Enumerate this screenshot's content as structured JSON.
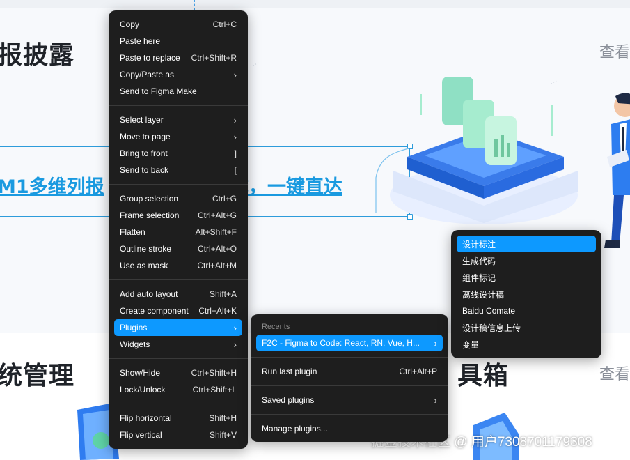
{
  "background": {
    "heading_top": "报披露",
    "heading_bottom_left": "统管理",
    "heading_bottom_right": "具箱",
    "view_more_top": "查看",
    "view_more_bottom": "查看",
    "banner_text_left": "M1多维列报",
    "banner_text_right": "成，一键直达",
    "footer_watermark": "掘金技术社区 @ 用户7308701179308",
    "accent_color": "#1a9ae0"
  },
  "context_menu": {
    "items": [
      {
        "label": "Copy",
        "shortcut": "Ctrl+C"
      },
      {
        "label": "Paste here",
        "shortcut": ""
      },
      {
        "label": "Paste to replace",
        "shortcut": "Ctrl+Shift+R"
      },
      {
        "label": "Copy/Paste as",
        "shortcut": "",
        "submenu": true
      },
      {
        "label": "Send to Figma Make",
        "shortcut": ""
      },
      {
        "label": "Select layer",
        "shortcut": "",
        "submenu": true
      },
      {
        "label": "Move to page",
        "shortcut": "",
        "submenu": true
      },
      {
        "label": "Bring to front",
        "shortcut": "]"
      },
      {
        "label": "Send to back",
        "shortcut": "["
      },
      {
        "label": "Group selection",
        "shortcut": "Ctrl+G"
      },
      {
        "label": "Frame selection",
        "shortcut": "Ctrl+Alt+G"
      },
      {
        "label": "Flatten",
        "shortcut": "Alt+Shift+F"
      },
      {
        "label": "Outline stroke",
        "shortcut": "Ctrl+Alt+O"
      },
      {
        "label": "Use as mask",
        "shortcut": "Ctrl+Alt+M"
      },
      {
        "label": "Add auto layout",
        "shortcut": "Shift+A"
      },
      {
        "label": "Create component",
        "shortcut": "Ctrl+Alt+K"
      },
      {
        "label": "Plugins",
        "shortcut": "",
        "submenu": true,
        "active": true
      },
      {
        "label": "Widgets",
        "shortcut": "",
        "submenu": true
      },
      {
        "label": "Show/Hide",
        "shortcut": "Ctrl+Shift+H"
      },
      {
        "label": "Lock/Unlock",
        "shortcut": "Ctrl+Shift+L"
      },
      {
        "label": "Flip horizontal",
        "shortcut": "Shift+H"
      },
      {
        "label": "Flip vertical",
        "shortcut": "Shift+V"
      }
    ]
  },
  "plugins_menu": {
    "recents_header": "Recents",
    "recent_item": "F2C - Figma to Code: React, RN, Vue, H...",
    "run_last": "Run last plugin",
    "run_last_shortcut": "Ctrl+Alt+P",
    "saved": "Saved plugins",
    "manage": "Manage plugins..."
  },
  "recent_submenu": {
    "items": [
      "设计标注",
      "生成代码",
      "组件标记",
      "离线设计稿",
      "Baidu Comate",
      "设计稿信息上传",
      "变量"
    ]
  }
}
